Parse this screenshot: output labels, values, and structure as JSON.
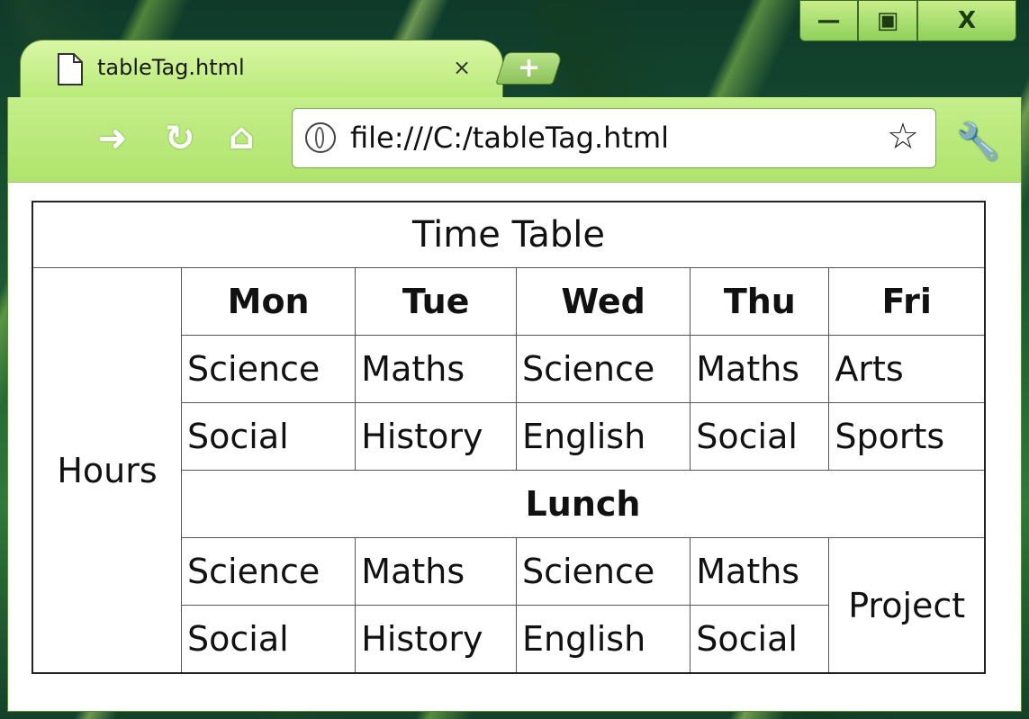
{
  "window": {
    "minimize_label": "—",
    "restore_label": "▣",
    "close_label": "X"
  },
  "tab": {
    "title": "tableTag.html",
    "close_label": "×",
    "new_tab_label": "+"
  },
  "toolbar": {
    "forward_label": "➜",
    "reload_label": "↻",
    "home_label": "⌂",
    "url": "file:///C:/tableTag.html",
    "star_label": "☆",
    "wrench_label": "🔧"
  },
  "table": {
    "caption": "Time Table",
    "row_header": "Hours",
    "days": [
      "Mon",
      "Tue",
      "Wed",
      "Thu",
      "Fri"
    ],
    "rows": [
      [
        "Science",
        "Maths",
        "Science",
        "Maths",
        "Arts"
      ],
      [
        "Social",
        "History",
        "English",
        "Social",
        "Sports"
      ]
    ],
    "lunch": "Lunch",
    "after_lunch": [
      [
        "Science",
        "Maths",
        "Science",
        "Maths"
      ],
      [
        "Social",
        "History",
        "English",
        "Social"
      ]
    ],
    "friday_after_lunch": "Project"
  },
  "colors": {
    "chrome_green": "#b9ea78",
    "table_border": "#222222"
  },
  "icons": [
    "page-icon",
    "close-icon",
    "new-tab-icon",
    "forward-icon",
    "reload-icon",
    "home-icon",
    "globe-icon",
    "star-icon",
    "wrench-icon",
    "minimize-icon",
    "restore-icon",
    "window-close-icon"
  ]
}
